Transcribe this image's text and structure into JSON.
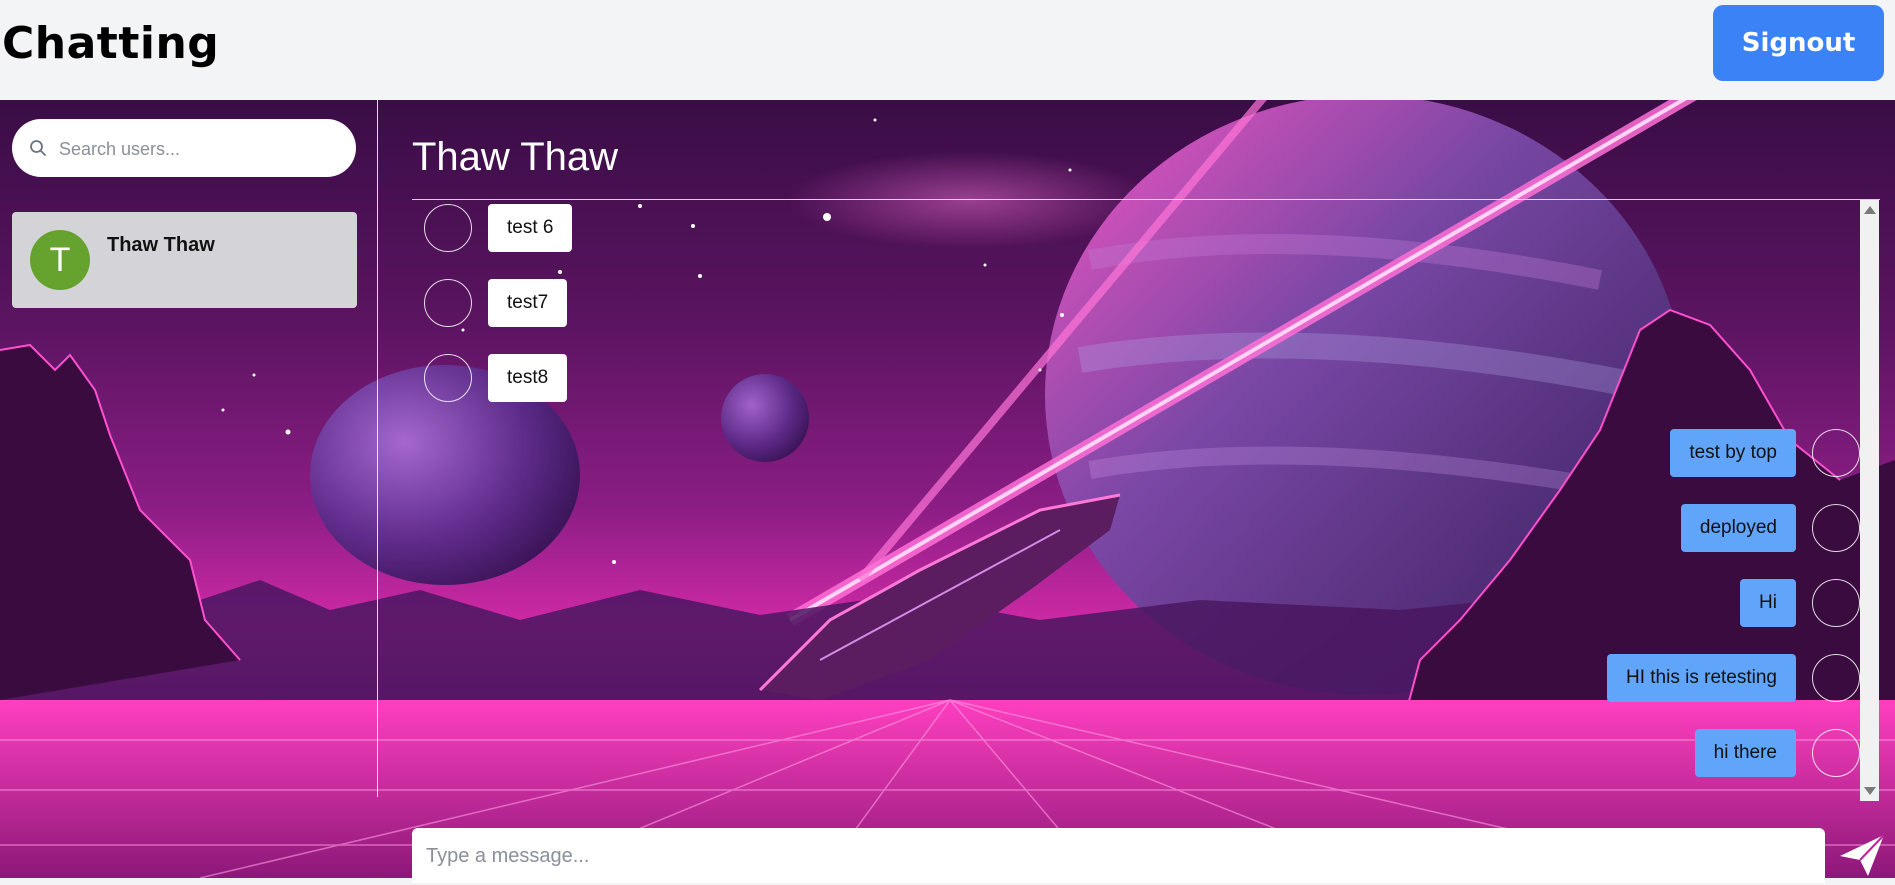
{
  "header": {
    "title": "Chatting",
    "signout_label": "Signout"
  },
  "sidebar": {
    "search_placeholder": "Search users...",
    "users": [
      {
        "initial": "T",
        "name": "Thaw Thaw",
        "avatar_color": "#65a32e"
      }
    ]
  },
  "chat": {
    "title": "Thaw Thaw",
    "messages": [
      {
        "side": "incoming",
        "text": "test 6"
      },
      {
        "side": "incoming",
        "text": "test7"
      },
      {
        "side": "incoming",
        "text": "test8"
      },
      {
        "side": "outgoing",
        "text": "test by top"
      },
      {
        "side": "outgoing",
        "text": "deployed"
      },
      {
        "side": "outgoing",
        "text": "Hi"
      },
      {
        "side": "outgoing",
        "text": "HI this is retesting"
      },
      {
        "side": "outgoing",
        "text": "hi there"
      }
    ],
    "composer_placeholder": "Type a message..."
  },
  "colors": {
    "accent": "#3b82f6",
    "outgoing_bubble": "#60a5fa",
    "incoming_bubble": "#ffffff",
    "background_theme": "#c21f9e"
  },
  "icons": {
    "search": "search-icon",
    "send": "send-icon"
  }
}
